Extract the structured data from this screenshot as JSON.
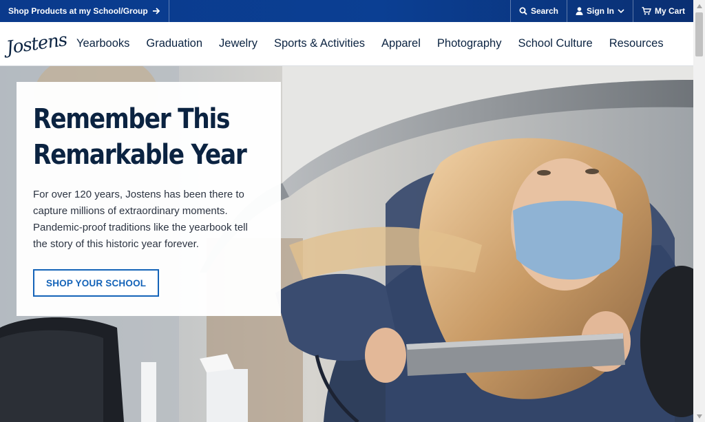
{
  "topbar": {
    "shop_link": "Shop Products at my School/Group",
    "search": "Search",
    "sign_in": "Sign In",
    "cart": "My Cart"
  },
  "brand": {
    "logo_text": "Jostens"
  },
  "nav": {
    "items": [
      "Yearbooks",
      "Graduation",
      "Jewelry",
      "Sports & Activities",
      "Apparel",
      "Photography",
      "School Culture",
      "Resources"
    ]
  },
  "hero": {
    "headline_line1": "Remember This",
    "headline_line2": "Remarkable Year",
    "body": "For over 120 years, Jostens has been there to capture millions of extraordinary moments. Pandemic-proof traditions like the yearbook tell the story of this historic year forever.",
    "cta": "SHOP YOUR SCHOOL"
  },
  "colors": {
    "brand_blue": "#0b3f93",
    "navy_text": "#0b2341",
    "cta_blue": "#1463b8"
  },
  "icons": [
    "arrow-right-icon",
    "search-icon",
    "user-icon",
    "chevron-down-icon",
    "cart-icon"
  ]
}
